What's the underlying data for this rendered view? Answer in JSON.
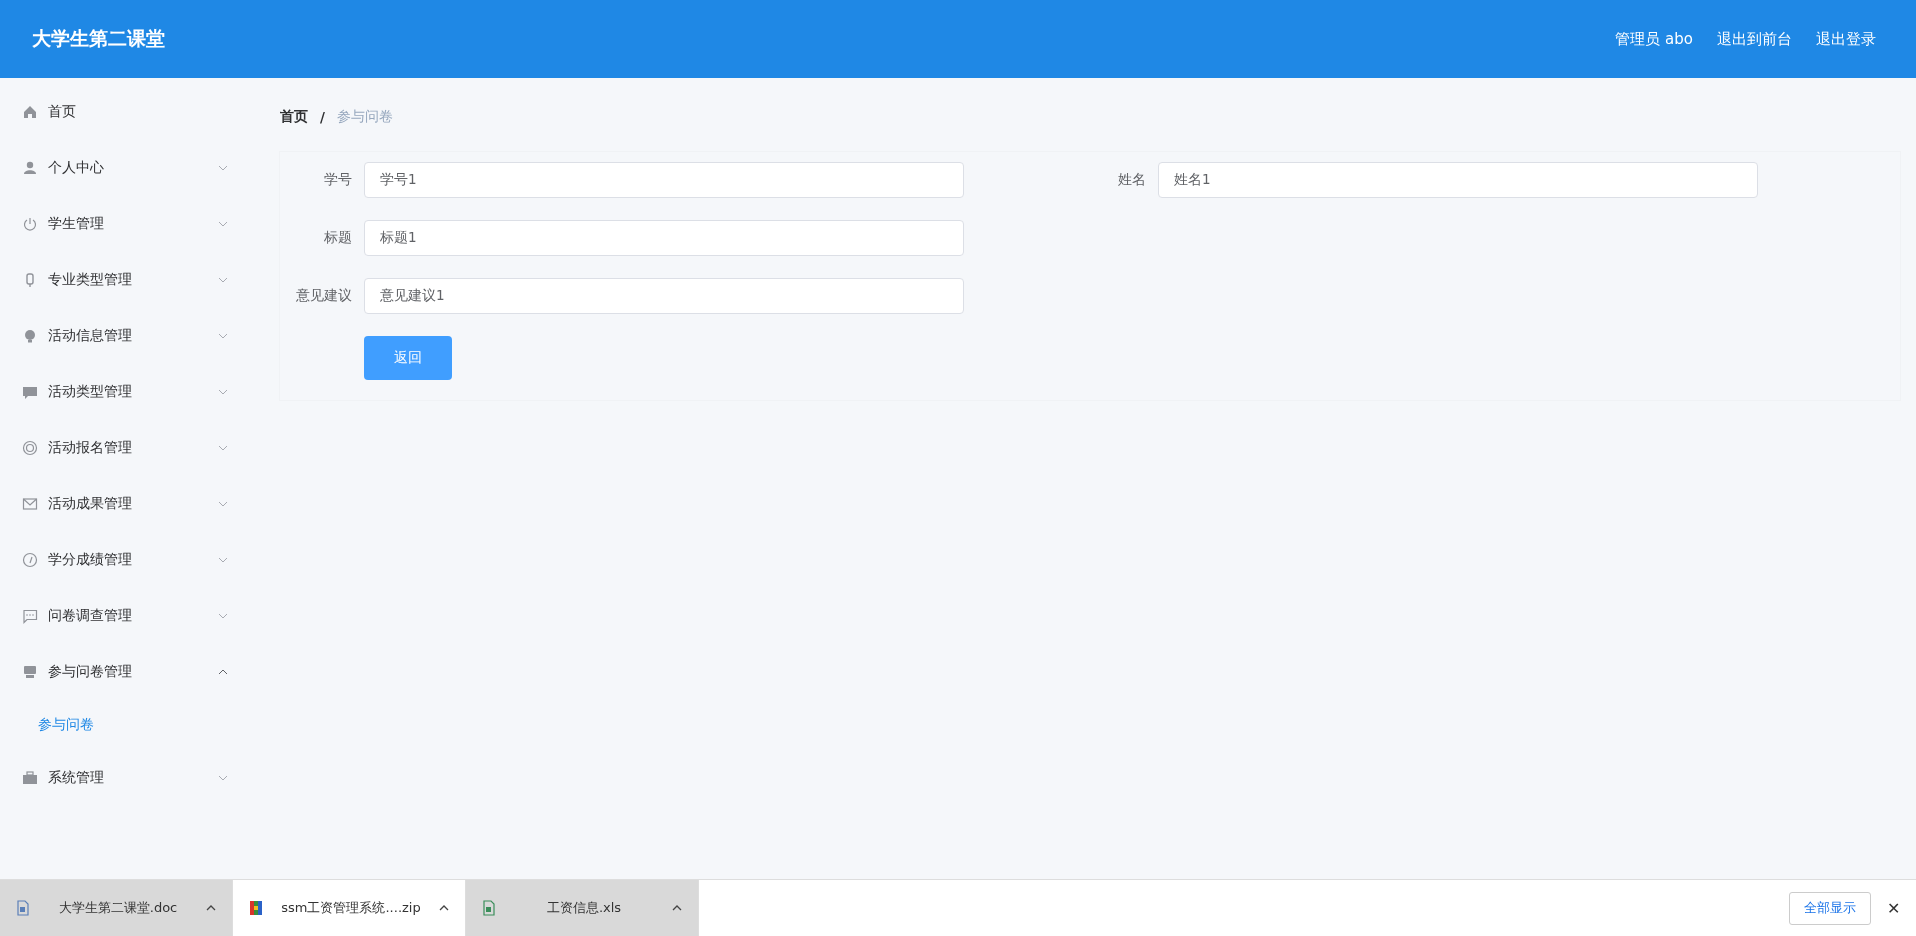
{
  "header": {
    "title": "大学生第二课堂",
    "links": [
      "管理员 abo",
      "退出到前台",
      "退出登录"
    ]
  },
  "sidebar": {
    "items": [
      {
        "label": "首页"
      },
      {
        "label": "个人中心",
        "expanded": false
      },
      {
        "label": "学生管理",
        "expanded": false
      },
      {
        "label": "专业类型管理",
        "expanded": false
      },
      {
        "label": "活动信息管理",
        "expanded": false
      },
      {
        "label": "活动类型管理",
        "expanded": false
      },
      {
        "label": "活动报名管理",
        "expanded": false
      },
      {
        "label": "活动成果管理",
        "expanded": false
      },
      {
        "label": "学分成绩管理",
        "expanded": false
      },
      {
        "label": "问卷调查管理",
        "expanded": false
      },
      {
        "label": "参与问卷管理",
        "expanded": true,
        "children": [
          {
            "label": "参与问卷",
            "selected": true
          }
        ]
      },
      {
        "label": "系统管理",
        "expanded": false
      }
    ]
  },
  "breadcrumb": {
    "items": [
      "首页",
      "参与问卷"
    ],
    "separator": "/"
  },
  "form": {
    "rows": [
      [
        {
          "label": "学号",
          "value": "学号1"
        },
        {
          "label": "姓名",
          "value": "姓名1"
        }
      ],
      [
        {
          "label": "标题",
          "value": "标题1"
        }
      ],
      [
        {
          "label": "意见建议",
          "value": "意见建议1"
        }
      ]
    ],
    "button": "返回"
  },
  "downloads": {
    "items": [
      {
        "name": "大学生第二课堂.doc",
        "highlighted": true
      },
      {
        "name": "ssm工资管理系统....zip",
        "highlighted": false
      },
      {
        "name": "工资信息.xls",
        "highlighted": true
      }
    ],
    "show_all": "全部显示",
    "close": "✕"
  }
}
